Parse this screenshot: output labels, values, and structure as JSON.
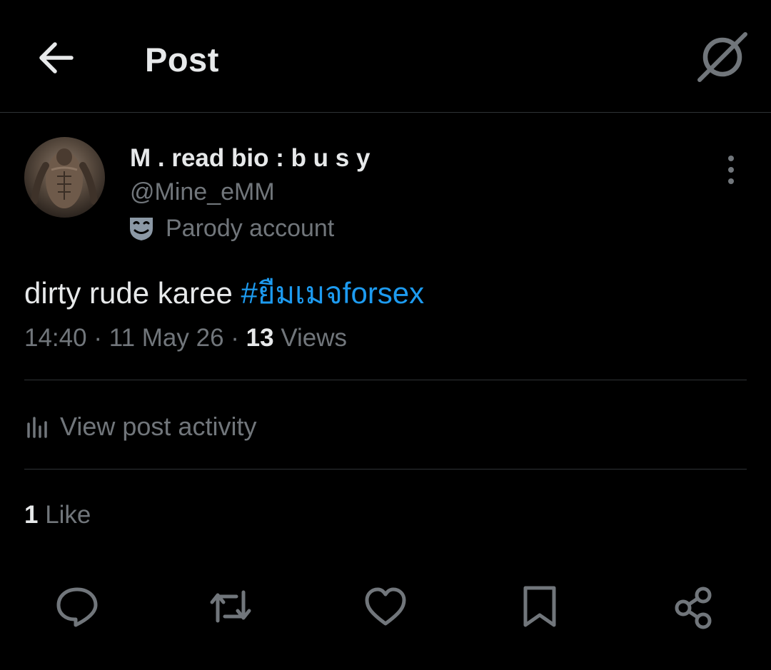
{
  "header": {
    "title": "Post",
    "back_icon": "arrow-left-icon",
    "grok_icon": "grok-icon"
  },
  "author": {
    "display_name": "M . read bio : b u s y",
    "handle": "@Mine_eMM",
    "badge_label": "Parody account",
    "badge_icon": "parody-mask-icon"
  },
  "post": {
    "text": "dirty rude karee ",
    "hashtag": "#ยืมเมจforsex"
  },
  "meta": {
    "time": "14:40",
    "separator": " · ",
    "date": "11 May 26",
    "views_count": "13",
    "views_label": " Views"
  },
  "activity": {
    "label": "View post activity",
    "icon": "analytics-icon"
  },
  "engagement": {
    "likes_count": "1",
    "likes_label": " Like"
  },
  "action_bar": {
    "icons": [
      "reply-icon",
      "repost-icon",
      "like-icon",
      "bookmark-icon",
      "share-icon"
    ]
  },
  "colors": {
    "background": "#000000",
    "text_primary": "#e7e9ea",
    "text_secondary": "#71767b",
    "accent": "#1d9bf0",
    "divider": "#2f3336"
  }
}
